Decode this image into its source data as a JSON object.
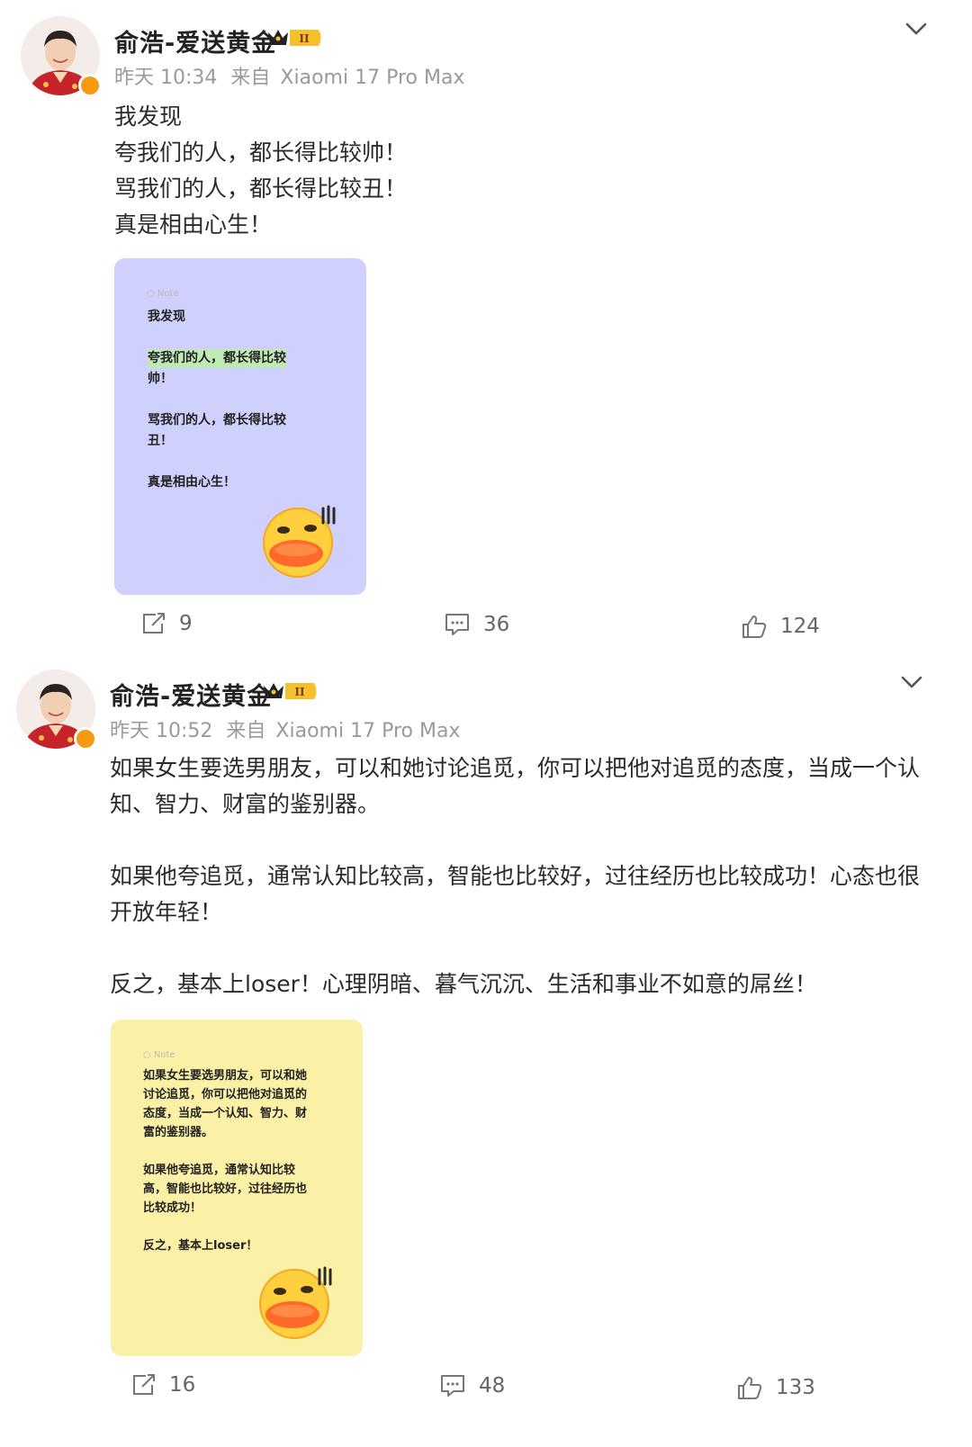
{
  "posts": [
    {
      "author": "俞浩-爱送黄金",
      "level_badge": "II",
      "time": "昨天 10:34",
      "source_prefix": "来自",
      "device": "Xiaomi 17 Pro Max",
      "lines": [
        "我发现",
        "夸我们的人，都长得比较帅！",
        "骂我们的人，都长得比较丑！",
        "真是相由心生！"
      ],
      "card": {
        "bg_color": "#cfd0fb",
        "note_label": "Note",
        "lines": [
          "我发现",
          "夸我们的人，都长得比较",
          "帅！",
          "骂我们的人，都长得比较",
          "丑！",
          "真是相由心生！"
        ]
      },
      "actions": {
        "repost": "9",
        "comment": "36",
        "like": "124"
      }
    },
    {
      "author": "俞浩-爱送黄金",
      "level_badge": "II",
      "time": "昨天 10:52",
      "source_prefix": "来自",
      "device": "Xiaomi 17 Pro Max",
      "lines": [
        "如果女生要选男朋友，可以和她讨论追觅，你可以把他对追觅的态度，当成一个认",
        "知、智力、财富的鉴别器。",
        "",
        "如果他夸追觅，通常认知比较高，智能也比较好，过往经历也比较成功！心态也很",
        "开放年轻！",
        "",
        "反之，基本上loser！心理阴暗、暮气沉沉、生活和事业不如意的屌丝！"
      ],
      "card": {
        "bg_color": "#fbf1a6",
        "note_label": "Note",
        "lines": [
          "如果女生要选男朋友，可以和她",
          "讨论追觅，你可以把他对追觅的",
          "态度，当成一个认知、智力、财",
          "富的鉴别器。",
          "如果他夸追觅，通常认知比较",
          "高，智能也比较好，过往经历也",
          "比较成功！",
          "反之，基本上loser！"
        ]
      },
      "actions": {
        "repost": "16",
        "comment": "48",
        "like": "133"
      }
    }
  ],
  "colors": {
    "verified": "#f79a12",
    "meta_gray": "#9a9a9a",
    "crown_gold": "#f5c02a"
  }
}
